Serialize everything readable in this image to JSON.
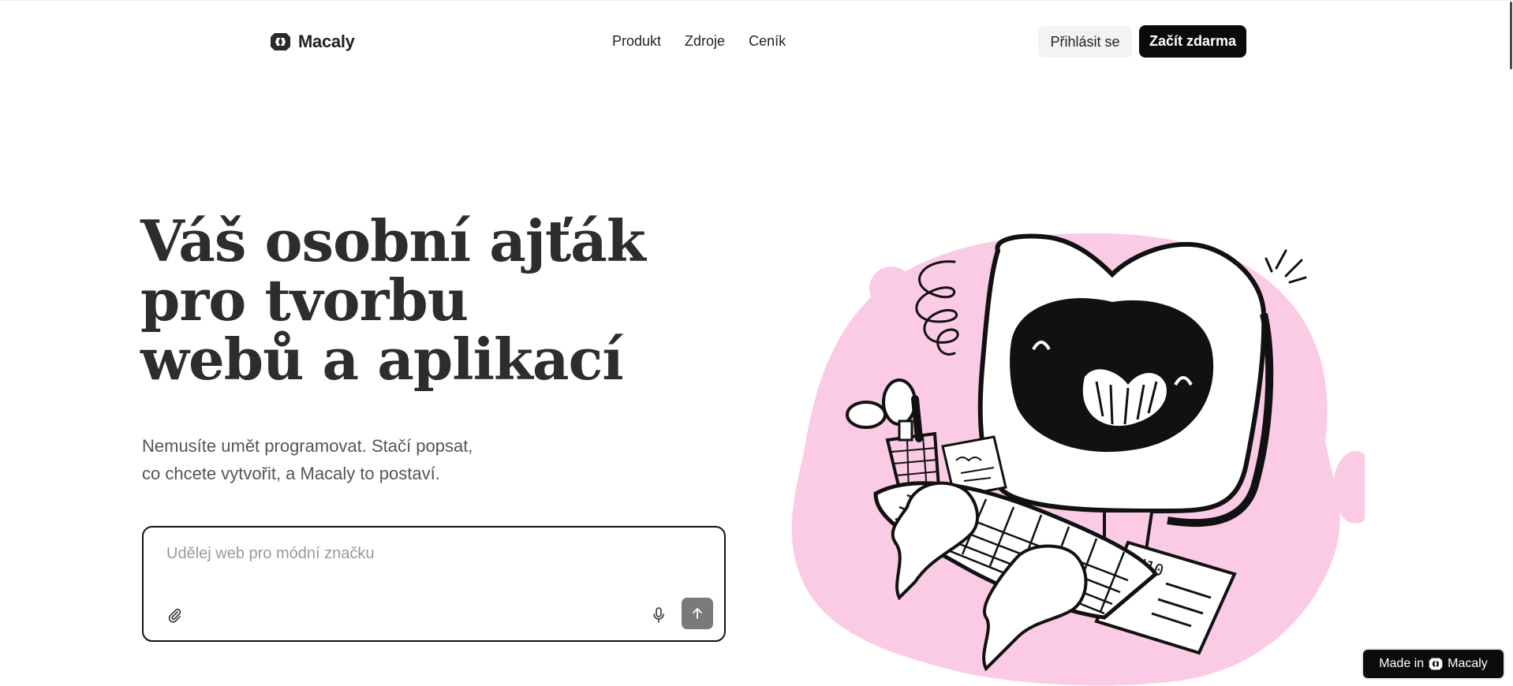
{
  "brand": {
    "name": "Macaly"
  },
  "nav": {
    "items": [
      {
        "label": "Produkt"
      },
      {
        "label": "Zdroje"
      },
      {
        "label": "Ceník"
      }
    ]
  },
  "header": {
    "login_label": "Přihlásit se",
    "start_label": "Začít zdarma"
  },
  "hero": {
    "headline_lines": [
      "Váš osobní ajťák",
      "pro tvorbu",
      "webů a aplikací"
    ],
    "sub_lines": [
      "Nemusíte umět programovat. Stačí popsat,",
      "co chcete vytvořit, a Macaly to postaví."
    ]
  },
  "prompt": {
    "placeholder": "Udělej web pro módní značku",
    "value": "",
    "icons": {
      "attach": "paperclip-icon",
      "mic": "microphone-icon",
      "send": "arrow-up-icon"
    }
  },
  "illustration": {
    "name": "monster-computer-illustration"
  },
  "badge": {
    "prefix": "Made in",
    "name": "Macaly"
  },
  "colors": {
    "accent_dark": "#0b0b0b",
    "illustration_pink": "#fbcbe6",
    "send_button": "#7a7a7a",
    "login_bg": "#f3f3f3"
  }
}
